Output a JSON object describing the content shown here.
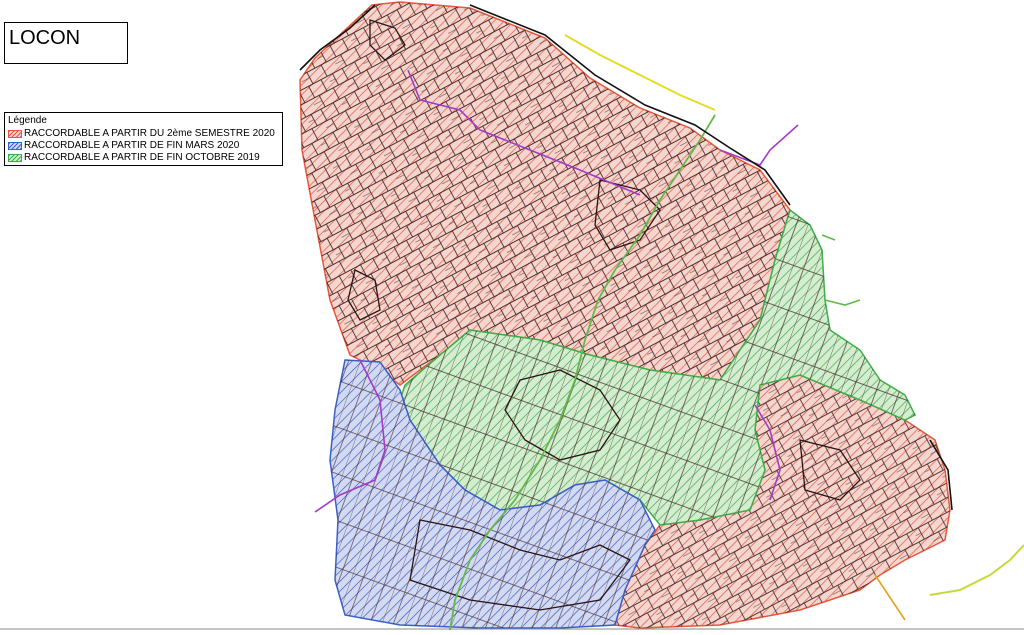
{
  "map_title": "LOCON",
  "legend": {
    "heading": "Légende",
    "items": [
      {
        "label": "RACCORDABLE A PARTIR DU 2ème SEMESTRE 2020",
        "color": "#e8573c",
        "fill": "#f2c8bd"
      },
      {
        "label": "RACCORDABLE A PARTIR DE FIN MARS 2020",
        "color": "#3a5fc8",
        "fill": "#c4cdee"
      },
      {
        "label": "RACCORDABLE A PARTIR DE FIN OCTOBRE 2019",
        "color": "#3fae49",
        "fill": "#c6e7c3"
      }
    ]
  },
  "colors": {
    "parcel_line": "#3a1d1d",
    "road_purple": "#a33ac9",
    "road_orange": "#e6a21e",
    "road_yellow": "#e8d92a",
    "road_green": "#62b94a"
  }
}
